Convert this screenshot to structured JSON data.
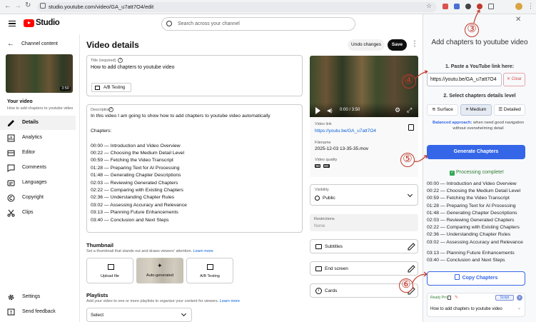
{
  "browser": {
    "url": "studio.youtube.com/video/GA_u7att7O4/edit"
  },
  "header": {
    "logo": "Studio",
    "search_placeholder": "Search across your channel"
  },
  "sidebar": {
    "channel_content": "Channel content",
    "thumb_duration": "3:50",
    "your_video": "Your video",
    "video_title": "How to add chapters to youtube video",
    "items": [
      {
        "label": "Details",
        "icon": "pencil-icon"
      },
      {
        "label": "Analytics",
        "icon": "analytics-icon"
      },
      {
        "label": "Editor",
        "icon": "editor-icon"
      },
      {
        "label": "Comments",
        "icon": "comments-icon"
      },
      {
        "label": "Languages",
        "icon": "languages-icon"
      },
      {
        "label": "Copyright",
        "icon": "copyright-icon"
      },
      {
        "label": "Clips",
        "icon": "scissors-icon"
      }
    ],
    "settings": "Settings",
    "feedback": "Send feedback"
  },
  "main": {
    "heading": "Video details",
    "undo": "Undo changes",
    "save": "Save",
    "title_label": "Title (required)",
    "title_value": "How to add chapters to youtube video",
    "ab_testing": "A/B Testing",
    "desc_label": "Description",
    "desc_intro": "In this video I am going to show how to add chapters to youtube video automatically",
    "desc_chapters_label": "Chapters:",
    "desc_chapters": [
      "00:00 — Introduction and Video Overview",
      "00:22 — Choosing the Medium Detail Level",
      "00:59 — Fetching the Video Transcript",
      "01:28 — Preparing Text for AI Processing",
      "01:48 — Generating Chapter Descriptions",
      "02:03 — Reviewing Generated Chapters",
      "02:22 — Comparing with Existing Chapters",
      "02:36 — Understanding Chapter Rules",
      "03:02 — Assessing Accuracy and Relevance",
      "03:13 — Planning Future Enhancements",
      "03:40 — Conclusion and Next Steps"
    ],
    "thumbnail_title": "Thumbnail",
    "thumbnail_sub": "Set a thumbnail that stands out and draws viewers' attention.",
    "learn_more": "Learn more",
    "upload_file": "Upload file",
    "auto_generated": "Auto-generated",
    "ab_testing2": "A/B Testing",
    "playlists_title": "Playlists",
    "playlists_sub": "Add your video to one or more playlists to organize your content for viewers.",
    "select": "Select"
  },
  "right": {
    "time": "0:00 / 3:50",
    "video_link_label": "Video link",
    "video_link": "https://youtu.be/GA_u7att7O4",
    "filename_label": "Filename",
    "filename": "2025-12-03 13-35-35.mov",
    "quality_label": "Video quality",
    "quality_badges": [
      "SD",
      "HD"
    ],
    "visibility_label": "Visibility",
    "visibility_value": "Public",
    "restrictions_label": "Restrictions",
    "restrictions_value": "None",
    "subtitles": "Subtitles",
    "end_screen": "End screen",
    "cards": "Cards"
  },
  "panel": {
    "title": "Add chapters to youtube video",
    "step1": "1. Paste a YouTube link here:",
    "link_value": "https://youtu.be/GA_u7att7O4",
    "clear": "Clear",
    "step2": "2. Select chapters details level",
    "levels": [
      "Surface",
      "Medium",
      "Detailed"
    ],
    "selected_level": "Medium",
    "approach_bold": "Balanced approach:",
    "approach_text": "when need good navigation without overwhelming detail",
    "generate": "Generate Chapters",
    "complete": "Processing complete!",
    "chapters_a": [
      "00:00 — Introduction and Video Overview",
      "00:22 — Choosing the Medium Detail Level",
      "00:59 — Fetching the Video Transcript",
      "01:28 — Preparing Text for AI Processing",
      "01:48 — Generating Chapter Descriptions",
      "02:03 — Reviewing Generated Chapters",
      "02:22 — Comparing with Existing Chapters",
      "02:36 — Understanding Chapter Rules",
      "03:02 — Assessing Accuracy and Relevance"
    ],
    "chapters_b": [
      "03:13 — Planning Future Enhancements",
      "03:40 — Conclusion and Next Steps"
    ],
    "copy": "Copy Chapters",
    "ready_pro": "Ready Pro",
    "script": "Script",
    "footer_title": "How to add chapters to youtube video"
  },
  "annotations": [
    "③",
    "④",
    "⑤",
    "⑥"
  ],
  "colors": {
    "accent": "#065fd4",
    "generate": "#3566e8",
    "annotation": "#c0392b",
    "youtube_red": "#ff0000"
  }
}
